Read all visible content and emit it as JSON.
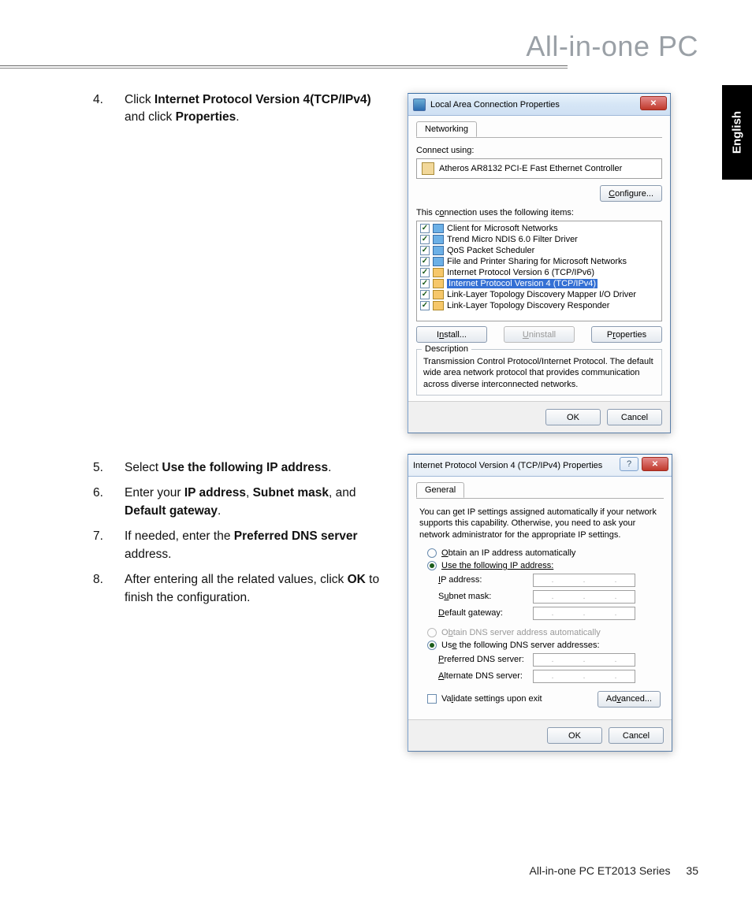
{
  "page": {
    "brand": "All-in-one PC",
    "lang_tab": "English",
    "footer_label": "All-in-one PC ET2013 Series",
    "footer_page": "35"
  },
  "instructions": {
    "step4": {
      "num": "4.",
      "pre": "Click ",
      "b1": "Internet Protocol Version 4(TCP/IPv4)",
      "mid": " and click ",
      "b2": "Properties",
      "post": "."
    },
    "step5": {
      "num": "5.",
      "pre": "Select ",
      "b1": "Use the following IP address",
      "post": "."
    },
    "step6": {
      "num": "6.",
      "pre": "Enter your ",
      "b1": "IP address",
      "mid1": ", ",
      "b2": "Subnet mask",
      "mid2": ", and ",
      "b3": "Default gateway",
      "post": "."
    },
    "step7": {
      "num": "7.",
      "pre": "If needed, enter the ",
      "b1": "Preferred DNS server",
      "post": " address."
    },
    "step8": {
      "num": "8.",
      "pre": "After entering all the related values, click ",
      "b1": "OK",
      "post": " to finish the configuration."
    }
  },
  "dlg1": {
    "title": "Local Area Connection Properties",
    "tab": "Networking",
    "connect_label": "Connect using:",
    "adapter": "Atheros AR8132 PCI-E Fast Ethernet Controller",
    "configure": "Configure...",
    "items_label": "This connection uses the following items:",
    "items": [
      "Client for Microsoft Networks",
      "Trend Micro NDIS 6.0 Filter Driver",
      "QoS Packet Scheduler",
      "File and Printer Sharing for Microsoft Networks",
      "Internet Protocol Version 6 (TCP/IPv6)",
      "Internet Protocol Version 4 (TCP/IPv4)",
      "Link-Layer Topology Discovery Mapper I/O Driver",
      "Link-Layer Topology Discovery Responder"
    ],
    "install": "Install...",
    "uninstall": "Uninstall",
    "properties": "Properties",
    "desc_label": "Description",
    "desc_text": "Transmission Control Protocol/Internet Protocol. The default wide area network protocol that provides communication across diverse interconnected networks.",
    "ok": "OK",
    "cancel": "Cancel"
  },
  "dlg2": {
    "title": "Internet Protocol Version 4 (TCP/IPv4) Properties",
    "tab": "General",
    "desc": "You can get IP settings assigned automatically if your network supports this capability. Otherwise, you need to ask your network administrator for the appropriate IP settings.",
    "r_auto_ip": "Obtain an IP address automatically",
    "r_use_ip": "Use the following IP address:",
    "f_ip": "IP address:",
    "f_mask": "Subnet mask:",
    "f_gw": "Default gateway:",
    "r_auto_dns": "Obtain DNS server address automatically",
    "r_use_dns": "Use the following DNS server addresses:",
    "f_dns1": "Preferred DNS server:",
    "f_dns2": "Alternate DNS server:",
    "validate": "Validate settings upon exit",
    "advanced": "Advanced...",
    "ok": "OK",
    "cancel": "Cancel"
  }
}
